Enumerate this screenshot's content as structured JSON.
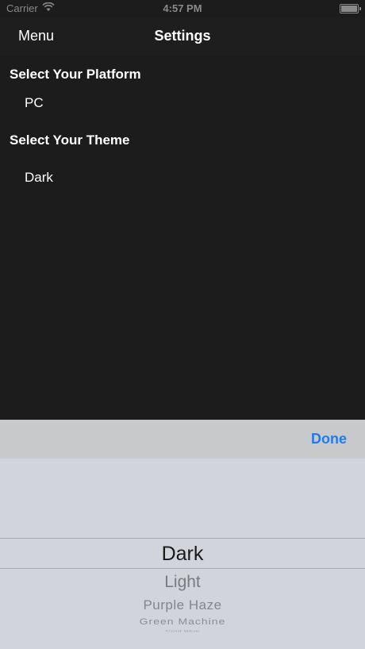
{
  "status_bar": {
    "carrier": "Carrier",
    "time": "4:57 PM",
    "wifi_icon": "wifi-icon",
    "battery_icon": "battery-icon"
  },
  "nav": {
    "back_label": "Menu",
    "title": "Settings"
  },
  "settings": {
    "platform_header": "Select Your Platform",
    "platform_value": "PC",
    "theme_header": "Select Your Theme",
    "theme_value": "Dark"
  },
  "picker": {
    "done_label": "Done",
    "options": [
      "Dark",
      "Light",
      "Purple Haze",
      "Green Machine",
      "Cool Blue"
    ],
    "selected": "Dark"
  },
  "colors": {
    "background": "#1c1c1c",
    "accent": "#1b7cf6",
    "picker_bg": "#d1d4da"
  }
}
